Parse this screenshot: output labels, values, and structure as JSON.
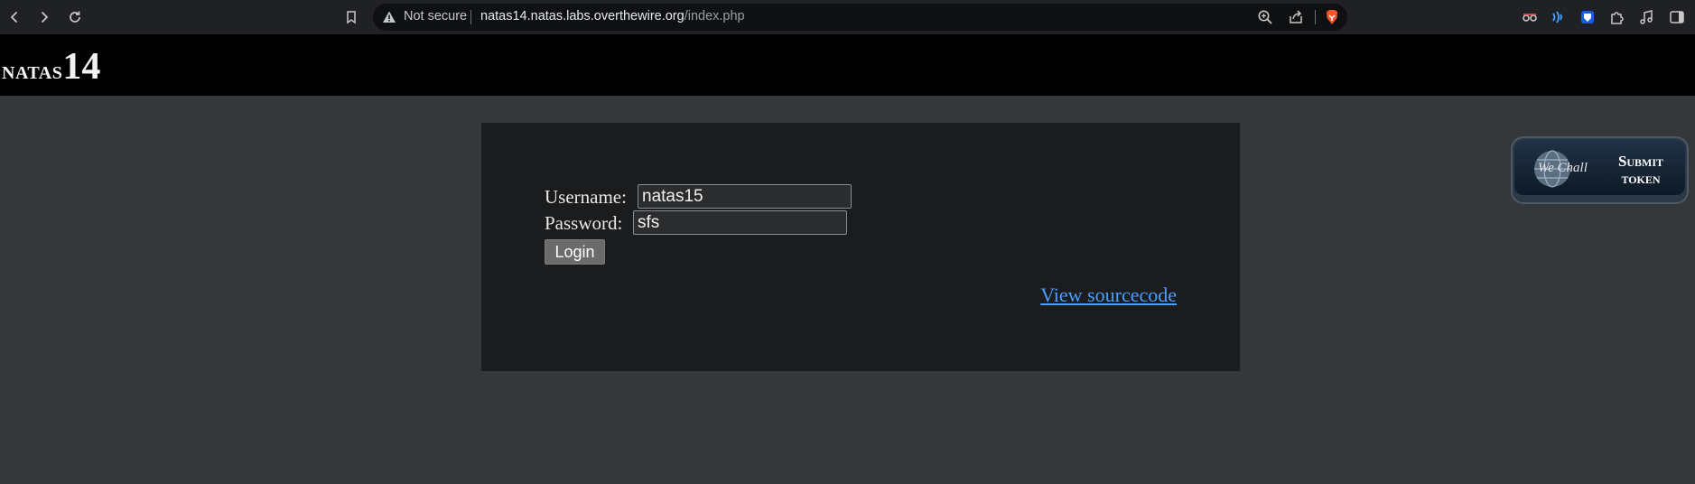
{
  "browser": {
    "security_label": "Not secure",
    "url_host": "natas14.natas.labs.overthewire.org",
    "url_path": "/index.php",
    "icons": [
      "back-icon",
      "forward-icon",
      "reload-icon",
      "bookmark-icon",
      "warning-icon",
      "zoom-icon",
      "share-icon",
      "brave-shield-icon",
      "incognito-icon",
      "speech-icon",
      "bitwarden-icon",
      "extensions-icon",
      "media-icon",
      "sidebar-icon"
    ]
  },
  "page": {
    "title_word": "natas",
    "title_number": "14",
    "form": {
      "username_label": "Username:",
      "username_value": "natas15",
      "password_label": "Password:",
      "password_value": "sfs",
      "login_label": "Login"
    },
    "view_source_label": "View sourcecode",
    "badge": {
      "wechall_text": "We Chall",
      "submit_line1": "Submit",
      "submit_line2": "token"
    }
  },
  "colors": {
    "page_background": "#35383b",
    "content_background": "#1b1c1d",
    "link": "#4a9eff",
    "brave_orange": "#fb542b"
  }
}
